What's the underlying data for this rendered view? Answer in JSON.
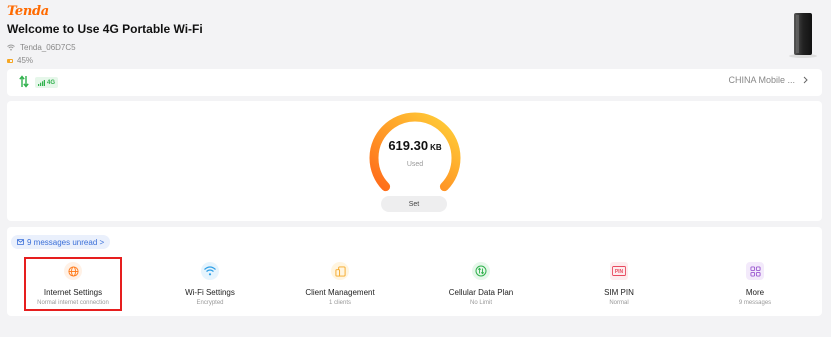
{
  "header": {
    "brand": "Tenda",
    "welcome": "Welcome to Use 4G Portable Wi-Fi",
    "ssid": "Tenda_06D7C5",
    "battery": "45%"
  },
  "status": {
    "network_type": "4G",
    "carrier": "CHINA Mobile ..."
  },
  "usage": {
    "value": "619.30",
    "unit": "KB",
    "label": "Used",
    "set_label": "Set"
  },
  "messages": {
    "unread_label": "9 messages unread >"
  },
  "tiles": [
    {
      "title": "Internet Settings",
      "subtitle": "Normal internet connection",
      "icon": "globe-icon",
      "color": "#ff7a1a",
      "bg": "#fff1e6"
    },
    {
      "title": "Wi-Fi Settings",
      "subtitle": "Encrypted",
      "icon": "wifi-icon",
      "color": "#2e9fe6",
      "bg": "#e6f4fd"
    },
    {
      "title": "Client Management",
      "subtitle": "1 clients",
      "icon": "devices-icon",
      "color": "#f5a623",
      "bg": "#fff5e0"
    },
    {
      "title": "Cellular Data Plan",
      "subtitle": "No Limit",
      "icon": "data-plan-icon",
      "color": "#2fb14c",
      "bg": "#e6f7ea"
    },
    {
      "title": "SIM PIN",
      "subtitle": "Normal",
      "icon": "pin-icon",
      "color": "#e84a5f",
      "bg": "#fdecee"
    },
    {
      "title": "More",
      "subtitle": "9 messages",
      "icon": "grid-icon",
      "color": "#9b59d0",
      "bg": "#f3eafb"
    }
  ],
  "colors": {
    "brand": "#ff6a00",
    "gauge_start": "#ff6a1a",
    "gauge_end": "#ffd23a",
    "selection": "#e61e1e"
  }
}
